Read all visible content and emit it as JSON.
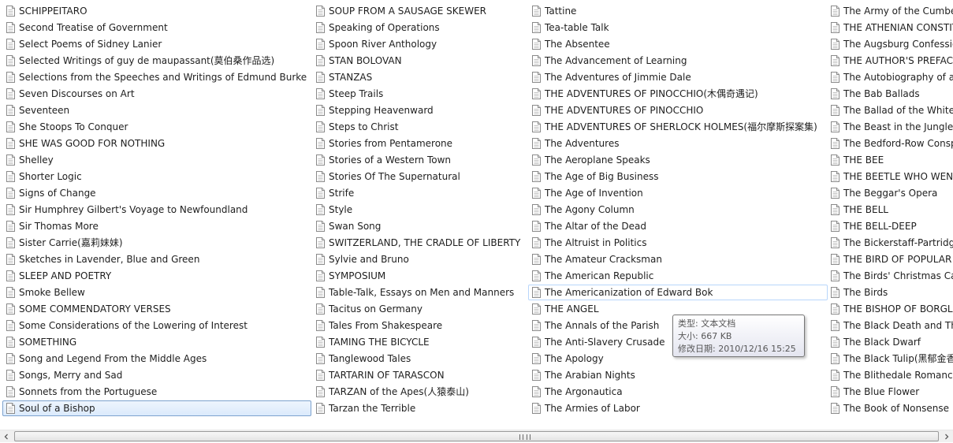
{
  "columns": [
    {
      "items": [
        "SCHIPPEITARO",
        "Second Treatise of Government",
        "Select Poems of Sidney Lanier",
        "Selected Writings of guy de maupassant(莫伯桑作品选)",
        "Selections from the Speeches and Writings of Edmund Burke",
        "Seven Discourses on Art",
        "Seventeen",
        "She Stoops To Conquer",
        "SHE WAS GOOD FOR NOTHING",
        "Shelley",
        "Shorter Logic",
        "Signs of Change",
        "Sir Humphrey Gilbert's Voyage to Newfoundland",
        "Sir Thomas More",
        "Sister Carrie(嘉莉妹妹)",
        "Sketches in Lavender, Blue and Green",
        "SLEEP AND POETRY",
        "Smoke Bellew",
        "SOME COMMENDATORY VERSES",
        "Some Considerations of the Lowering of Interest",
        "SOMETHING",
        "Song and Legend From the Middle Ages",
        "Songs, Merry and Sad",
        "Sonnets from the Portuguese",
        "Soul of a Bishop"
      ]
    },
    {
      "items": [
        "SOUP FROM A SAUSAGE SKEWER",
        "Speaking of Operations",
        "Spoon River Anthology",
        "STAN BOLOVAN",
        "STANZAS",
        "Steep Trails",
        "Stepping Heavenward",
        "Steps to Christ",
        "Stories from Pentamerone",
        "Stories of a Western Town",
        "Stories Of The Supernatural",
        "Strife",
        "Style",
        "Swan Song",
        "SWITZERLAND, THE CRADLE OF LIBERTY",
        "Sylvie and Bruno",
        "SYMPOSIUM",
        "Table-Talk, Essays on Men and Manners",
        "Tacitus on Germany",
        "Tales From Shakespeare",
        "TAMING THE BICYCLE",
        "Tanglewood Tales",
        "TARTARIN OF TARASCON",
        "TARZAN of the Apes(人猿泰山)",
        "Tarzan the Terrible"
      ]
    },
    {
      "items": [
        "Tattine",
        "Tea-table Talk",
        "The Absentee",
        "The Advancement of Learning",
        "The Adventures of Jimmie Dale",
        "THE ADVENTURES OF PINOCCHIO(木偶奇遇记)",
        "THE ADVENTURES OF PINOCCHIO",
        "THE ADVENTURES OF SHERLOCK HOLMES(福尔摩斯探案集)",
        "The Adventures",
        "The Aeroplane Speaks",
        "The Age of Big Business",
        "The Age of Invention",
        "The Agony Column",
        "The Altar of the Dead",
        "The Altruist in Politics",
        "The Amateur Cracksman",
        "The American Republic",
        "The Americanization of Edward Bok",
        "THE ANGEL",
        "The Annals of the Parish",
        "The Anti-Slavery Crusade",
        "The Apology",
        "The Arabian Nights",
        "The Argonautica",
        "The Armies of Labor"
      ]
    },
    {
      "items": [
        "The Army of the Cumberland",
        "THE ATHENIAN CONSTITUTION",
        "The Augsburg Confession",
        "THE AUTHOR'S PREFACE",
        "The Autobiography of a Super-Tramp",
        "The Bab Ballads",
        "The Ballad of the White Horse",
        "The Beast in the Jungle",
        "The Bedford-Row Conspiracy",
        "THE BEE",
        "THE BEETLE WHO WENT ON HIS TRAVELS",
        "The Beggar's Opera",
        "THE BELL",
        "THE BELL-DEEP",
        "The Bickerstaff-Partridge Papers",
        "THE BIRD OF POPULAR SONG",
        "The Birds' Christmas Carol",
        "The Birds",
        "THE BISHOP OF BORGLUM AND HIS WARRIORS",
        "The Black Death and The Dancing Mania",
        "The Black Dwarf",
        "The Black Tulip(黑郁金香)",
        "The Blithedale Romance",
        "The Blue Flower",
        "The Book of Nonsense"
      ]
    }
  ],
  "selected_item": "Soul of a Bishop",
  "hot_item": "The Americanization of Edward Bok",
  "tooltip": {
    "type": "类型: 文本文档",
    "size": "大小: 667 KB",
    "modified": "修改日期: 2010/12/16 15:25"
  },
  "scrollbar": {
    "left_arrow": "scroll-left",
    "right_arrow": "scroll-right"
  },
  "colors": {
    "selection_border": "#7da2ce",
    "hot_border": "#b8d6fb",
    "tooltip_text": "#575757"
  }
}
